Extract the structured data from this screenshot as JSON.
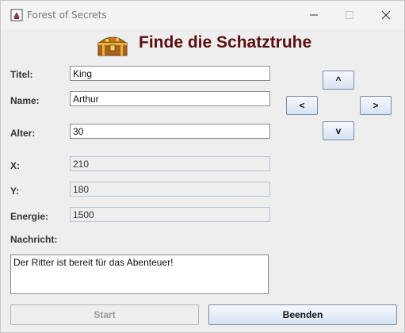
{
  "window": {
    "title": "Forest of Secrets",
    "controls": {
      "minimize": "—",
      "maximize": "☐",
      "close": "✕"
    }
  },
  "header": {
    "title": "Finde die Schatztruhe",
    "icon": "treasure-chest-icon"
  },
  "form": {
    "title_label": "Titel:",
    "title_value": "King",
    "name_label": "Name:",
    "name_value": "Arthur",
    "age_label": "Alter:",
    "age_value": "30",
    "x_label": "X:",
    "x_value": "210",
    "y_label": "Y:",
    "y_value": "180",
    "energy_label": "Energie:",
    "energy_value": "1500",
    "message_label": "Nachricht:",
    "message_value": "Der Ritter ist bereit für das Abenteuer!"
  },
  "arrows": {
    "up": "^",
    "left": "<",
    "right": ">",
    "down": "v"
  },
  "buttons": {
    "start": "Start",
    "start_enabled": false,
    "quit": "Beenden"
  },
  "colors": {
    "title": "#5a0f0f",
    "button_border": "#7a8ea8"
  }
}
